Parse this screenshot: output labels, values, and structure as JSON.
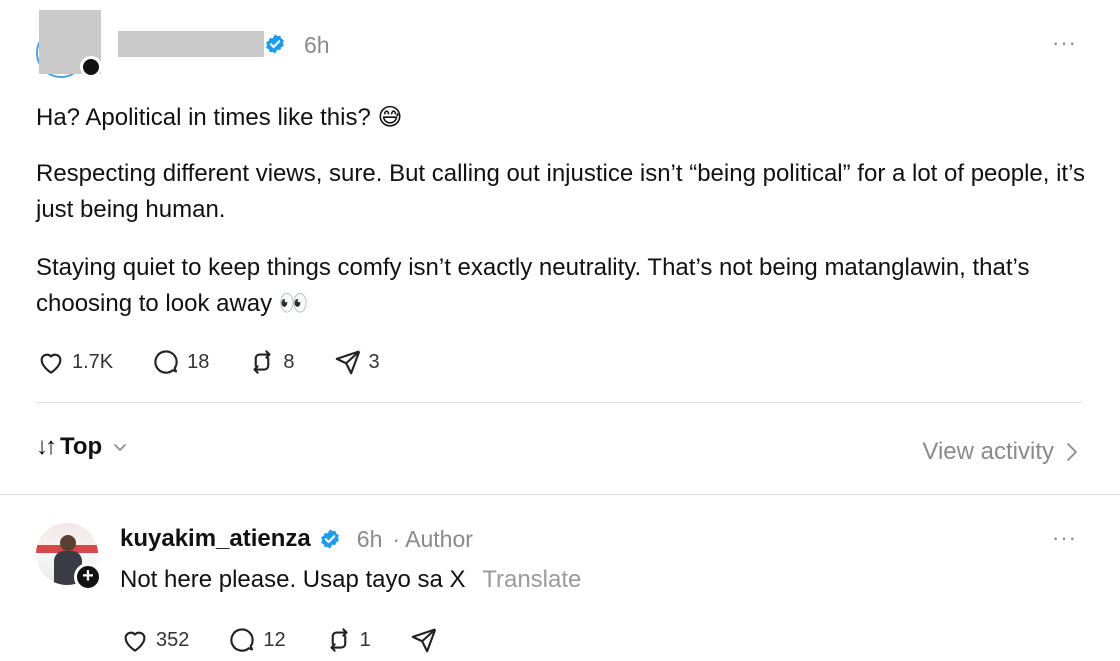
{
  "post": {
    "time": "6h",
    "more": "···",
    "paragraphs": [
      "Ha? Apolitical in times like this? 😅",
      "Respecting different views, sure. But calling out injustice isn’t “being political” for a lot of people, it’s just being human.",
      "Staying quiet to keep things comfy isn’t exactly neutrality. That’s not being matanglawin, that’s choosing to look away 👀"
    ],
    "likes": "1.7K",
    "comments": "18",
    "reposts": "8",
    "shares": "3"
  },
  "sort": {
    "label": "Top",
    "arrows": "↓↑",
    "view_activity": "View activity"
  },
  "reply": {
    "username": "kuyakim_atienza",
    "time": "6h",
    "author_badge": "· Author",
    "text": "Not here please. Usap tayo sa X",
    "translate": "Translate",
    "likes": "352",
    "comments": "12",
    "reposts": "1",
    "more": "···"
  },
  "colors": {
    "verified": "#1d9bf0",
    "muted": "#8a8a8a"
  }
}
